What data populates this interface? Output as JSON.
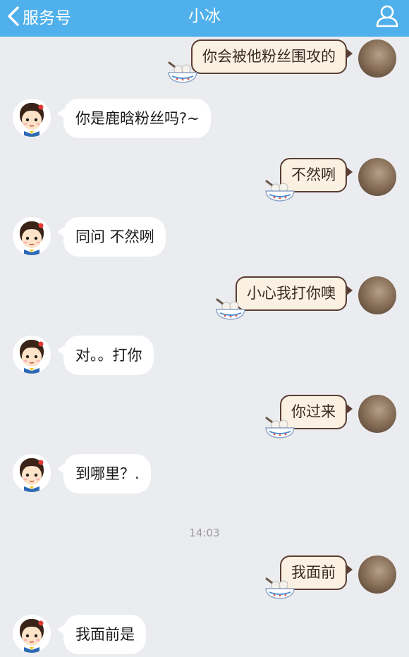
{
  "header": {
    "back_label": "服务号",
    "title": "小冰"
  },
  "colors": {
    "header_bg": "#4fb0eb",
    "chat_bg": "#ebecf0",
    "user_bubble_bg": "#fbf1e3",
    "user_bubble_border": "#5a3d32",
    "bot_bubble_bg": "#ffffff"
  },
  "messages": [
    {
      "from": "user",
      "text": "你会被他粉丝围攻的"
    },
    {
      "from": "bot",
      "text": "你是鹿晗粉丝吗?~"
    },
    {
      "from": "user",
      "text": "不然咧"
    },
    {
      "from": "bot",
      "text": "同问 不然咧"
    },
    {
      "from": "user",
      "text": "小心我打你噢"
    },
    {
      "from": "bot",
      "text": "对。。打你"
    },
    {
      "from": "user",
      "text": "你过来"
    },
    {
      "from": "bot",
      "text": "到哪里？."
    },
    {
      "from": "user",
      "text": "我面前"
    },
    {
      "from": "bot",
      "text": "我面前是"
    }
  ],
  "timestamp": "14:03"
}
